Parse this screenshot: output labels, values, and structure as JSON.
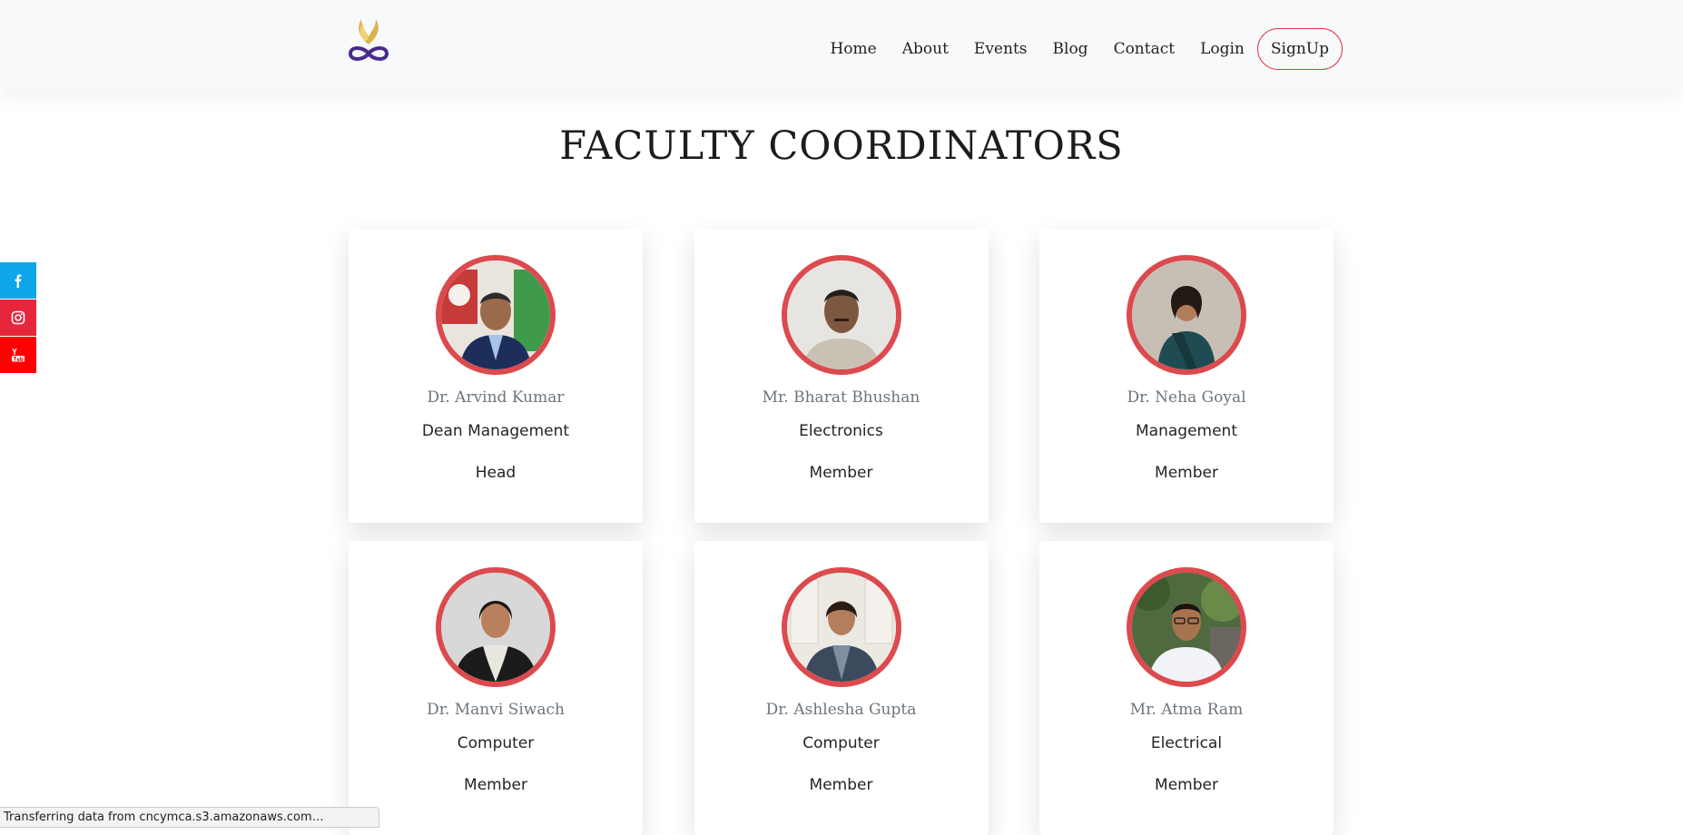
{
  "nav": {
    "logo_icon": "infinity-flame-logo",
    "links": [
      "Home",
      "About",
      "Events",
      "Blog",
      "Contact",
      "Login"
    ],
    "signup_label": "SignUp"
  },
  "page": {
    "title": "FACULTY COORDINATORS"
  },
  "social": [
    {
      "icon": "facebook-icon",
      "color": "#0ea5e9"
    },
    {
      "icon": "instagram-icon",
      "color": "#e7263b"
    },
    {
      "icon": "youtube-icon",
      "color": "#ff0000"
    }
  ],
  "members": [
    {
      "name": "Dr. Arvind Kumar",
      "dept": "Dean Management",
      "role": "Head"
    },
    {
      "name": "Mr. Bharat Bhushan",
      "dept": "Electronics",
      "role": "Member"
    },
    {
      "name": "Dr. Neha Goyal",
      "dept": "Management",
      "role": "Member"
    },
    {
      "name": "Dr. Manvi Siwach",
      "dept": "Computer",
      "role": "Member"
    },
    {
      "name": "Dr. Ashlesha Gupta",
      "dept": "Computer",
      "role": "Member"
    },
    {
      "name": "Mr. Atma Ram",
      "dept": "Electrical",
      "role": "Member"
    }
  ],
  "status_bar": "Transferring data from cncymca.s3.amazonaws.com…",
  "colors": {
    "accent": "#dc4a4e",
    "signup_border": "#dc3545",
    "navbar_bg": "#f8f9fa"
  }
}
